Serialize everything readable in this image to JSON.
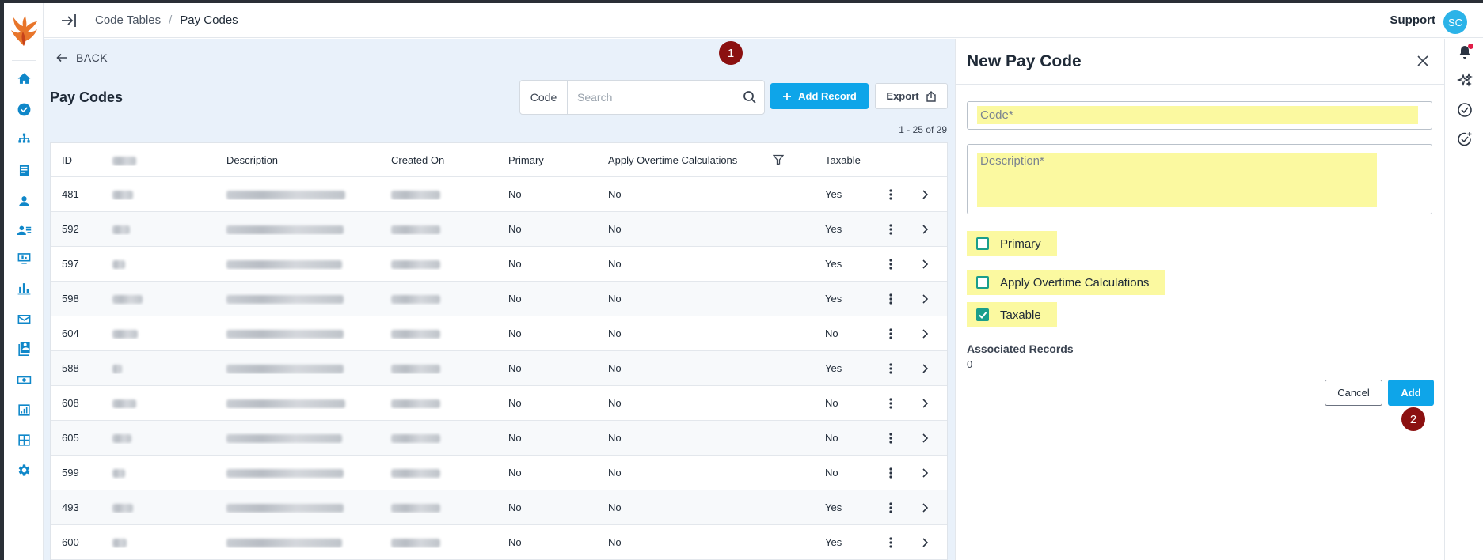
{
  "header": {
    "breadcrumb": [
      "Code Tables",
      "Pay Codes"
    ],
    "breadcrumb_sep": "/",
    "support_label": "Support",
    "avatar_initials": "SC"
  },
  "main": {
    "back_label": "BACK",
    "page_title": "Pay Codes",
    "search": {
      "label": "Code",
      "placeholder": "Search"
    },
    "add_record_label": "Add Record",
    "export_label": "Export",
    "pagination": "1 - 25 of 29",
    "table": {
      "columns": [
        "ID",
        "Code",
        "Description",
        "Created On",
        "Primary",
        "Apply Overtime Calculations",
        "Taxable"
      ],
      "rows": [
        {
          "id": "481",
          "primary": "No",
          "apply_ot": "No",
          "taxable": "Yes"
        },
        {
          "id": "592",
          "primary": "No",
          "apply_ot": "No",
          "taxable": "Yes"
        },
        {
          "id": "597",
          "primary": "No",
          "apply_ot": "No",
          "taxable": "Yes"
        },
        {
          "id": "598",
          "primary": "No",
          "apply_ot": "No",
          "taxable": "Yes"
        },
        {
          "id": "604",
          "primary": "No",
          "apply_ot": "No",
          "taxable": "No"
        },
        {
          "id": "588",
          "primary": "No",
          "apply_ot": "No",
          "taxable": "Yes"
        },
        {
          "id": "608",
          "primary": "No",
          "apply_ot": "No",
          "taxable": "No"
        },
        {
          "id": "605",
          "primary": "No",
          "apply_ot": "No",
          "taxable": "No"
        },
        {
          "id": "599",
          "primary": "No",
          "apply_ot": "No",
          "taxable": "No"
        },
        {
          "id": "493",
          "primary": "No",
          "apply_ot": "No",
          "taxable": "Yes"
        },
        {
          "id": "600",
          "primary": "No",
          "apply_ot": "No",
          "taxable": "Yes"
        }
      ]
    }
  },
  "panel": {
    "title": "New Pay Code",
    "code_placeholder": "Code*",
    "description_placeholder": "Description*",
    "checkboxes": [
      {
        "label": "Primary",
        "checked": false
      },
      {
        "label": "Apply Overtime Calculations",
        "checked": false
      },
      {
        "label": "Taxable",
        "checked": true
      }
    ],
    "associated_label": "Associated Records",
    "associated_value": "0",
    "cancel_label": "Cancel",
    "add_label": "Add"
  },
  "markers": [
    "1",
    "2"
  ],
  "colors": {
    "primary": "#0ea5e9",
    "brand_rail": "#0f87c9",
    "highlight": "#fbf9a0",
    "checkbox": "#1a9e8b",
    "marker": "#8b1010",
    "main_bg": "#e9f1fa"
  },
  "icons": {
    "rail": [
      "home-icon",
      "check-circle-icon",
      "org-chart-icon",
      "document-icon",
      "person-icon",
      "people-list-icon",
      "monitor-icon",
      "bar-chart-icon",
      "mail-icon",
      "contacts-book-icon",
      "money-icon",
      "report-icon",
      "dashboard-icon",
      "gear-icon"
    ],
    "right_rail": [
      "bell-icon",
      "sparkles-icon",
      "check-circle-outline-icon",
      "check-circle-add-icon"
    ]
  }
}
